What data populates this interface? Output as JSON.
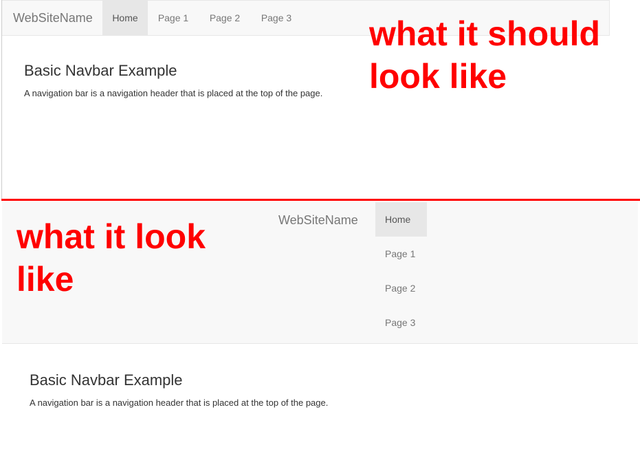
{
  "top_panel": {
    "navbar": {
      "brand": "WebSiteName",
      "items": [
        {
          "label": "Home",
          "active": true
        },
        {
          "label": "Page 1",
          "active": false
        },
        {
          "label": "Page 2",
          "active": false
        },
        {
          "label": "Page 3",
          "active": false
        }
      ]
    },
    "heading": "Basic Navbar Example",
    "text": "A navigation bar is a navigation header that is placed at the top of the page."
  },
  "bottom_panel": {
    "navbar": {
      "brand": "WebSiteName",
      "items": [
        {
          "label": "Home",
          "active": true
        },
        {
          "label": "Page 1",
          "active": false
        },
        {
          "label": "Page 2",
          "active": false
        },
        {
          "label": "Page 3",
          "active": false
        }
      ]
    },
    "heading": "Basic Navbar Example",
    "text": "A navigation bar is a navigation header that is placed at the top of the page."
  },
  "annotations": {
    "expected": "what it should look like",
    "actual": "what it look like"
  },
  "colors": {
    "annotation": "#ff0000",
    "navbar_bg": "#f8f8f8",
    "active_item_bg": "#e7e7e7"
  }
}
